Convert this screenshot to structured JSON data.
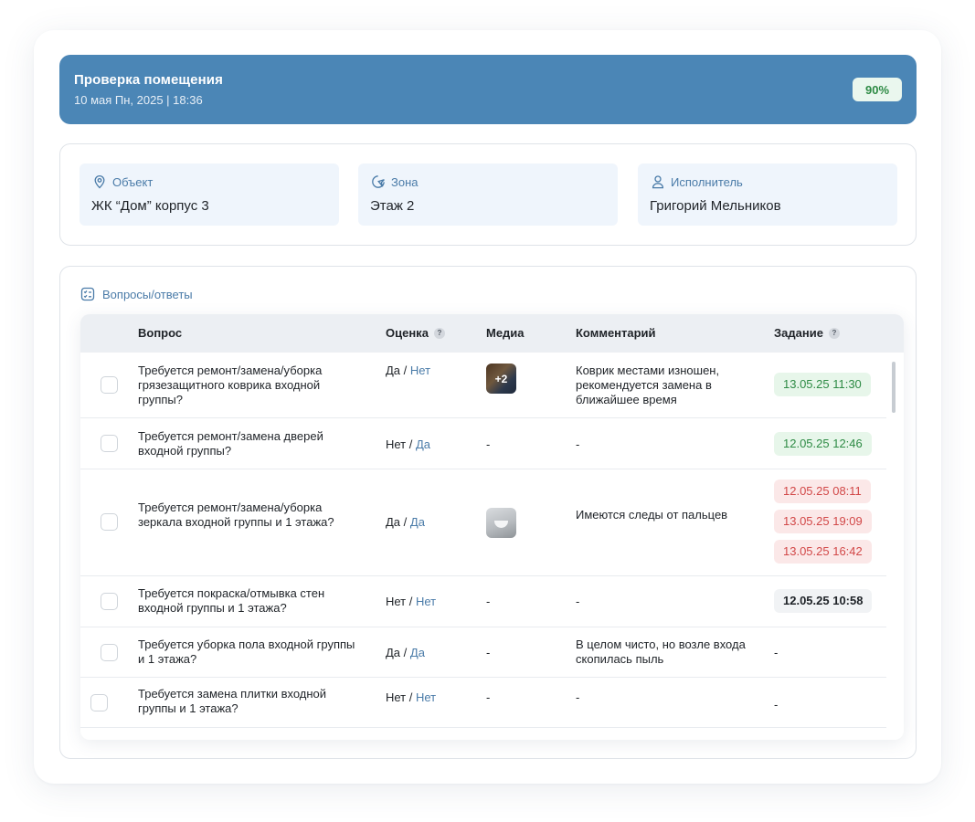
{
  "header": {
    "title": "Проверка помещения",
    "subtitle": "10 мая Пн, 2025 | 18:36",
    "progress_label": "90%",
    "progress_value": 0.9
  },
  "info": [
    {
      "label": "Объект",
      "icon": "location-pin-icon",
      "value": "ЖК “Дом” корпус 3"
    },
    {
      "label": "Зона",
      "icon": "zone-icon",
      "value": "Этаж 2"
    },
    {
      "label": "Исполнитель",
      "icon": "user-icon",
      "value": "Григорий Мельников"
    }
  ],
  "qa": {
    "title": "Вопросы/ответы",
    "columns": {
      "question": "Вопрос",
      "score": "Оценка",
      "media": "Медиа",
      "comment": "Комментарий",
      "task": "Задание",
      "help": "?"
    },
    "rows": [
      {
        "question": "Требуется ремонт/замена/уборка грязезащитного коврика входной группы?",
        "score_main": "Да",
        "score_sep": " / ",
        "score_alt": "Нет",
        "media_count": "+2",
        "comment": "Коврик местами изношен, рекомендуется замена в ближайшее время",
        "tasks": [
          "13.05.25 11:30"
        ]
      },
      {
        "question": "Требуется ремонт/замена дверей входной группы?",
        "score_main": "Нет",
        "score_sep": " / ",
        "score_alt": "Да",
        "media_empty": "-",
        "comment": "-",
        "tasks": [
          "12.05.25 12:46"
        ]
      },
      {
        "question": "Требуется ремонт/замена/уборка зеркала входной группы и 1 этажа?",
        "score_main": "Да",
        "score_sep": " / ",
        "score_alt": "Да",
        "comment": "Имеются следы от пальцев",
        "tasks": [
          "12.05.25 08:11",
          "13.05.25 19:09",
          "13.05.25 16:42"
        ]
      },
      {
        "question": "Требуется покраска/отмывка стен входной группы и 1 этажа?",
        "score_main": "Нет",
        "score_sep": " / ",
        "score_alt": "Нет",
        "media_empty": "-",
        "comment": "-",
        "tasks": [
          "12.05.25 10:58"
        ]
      },
      {
        "question": "Требуется уборка пола входной группы и 1 этажа?",
        "score_main": "Да",
        "score_sep": " / ",
        "score_alt": "Да",
        "media_empty": "-",
        "comment": "В целом чисто, но возле входа скопилась пыль",
        "task_empty": "-"
      },
      {
        "question": "Требуется замена плитки входной группы и 1 этажа?",
        "score_main": "Нет",
        "score_sep": " / ",
        "score_alt": "Нет",
        "media_empty": "-",
        "comment": "-",
        "task_empty": "-"
      }
    ]
  },
  "colors": {
    "banner": "#4b86b6",
    "accent": "#4a7ba8",
    "success": "#2e8b45",
    "danger": "#d24848"
  }
}
